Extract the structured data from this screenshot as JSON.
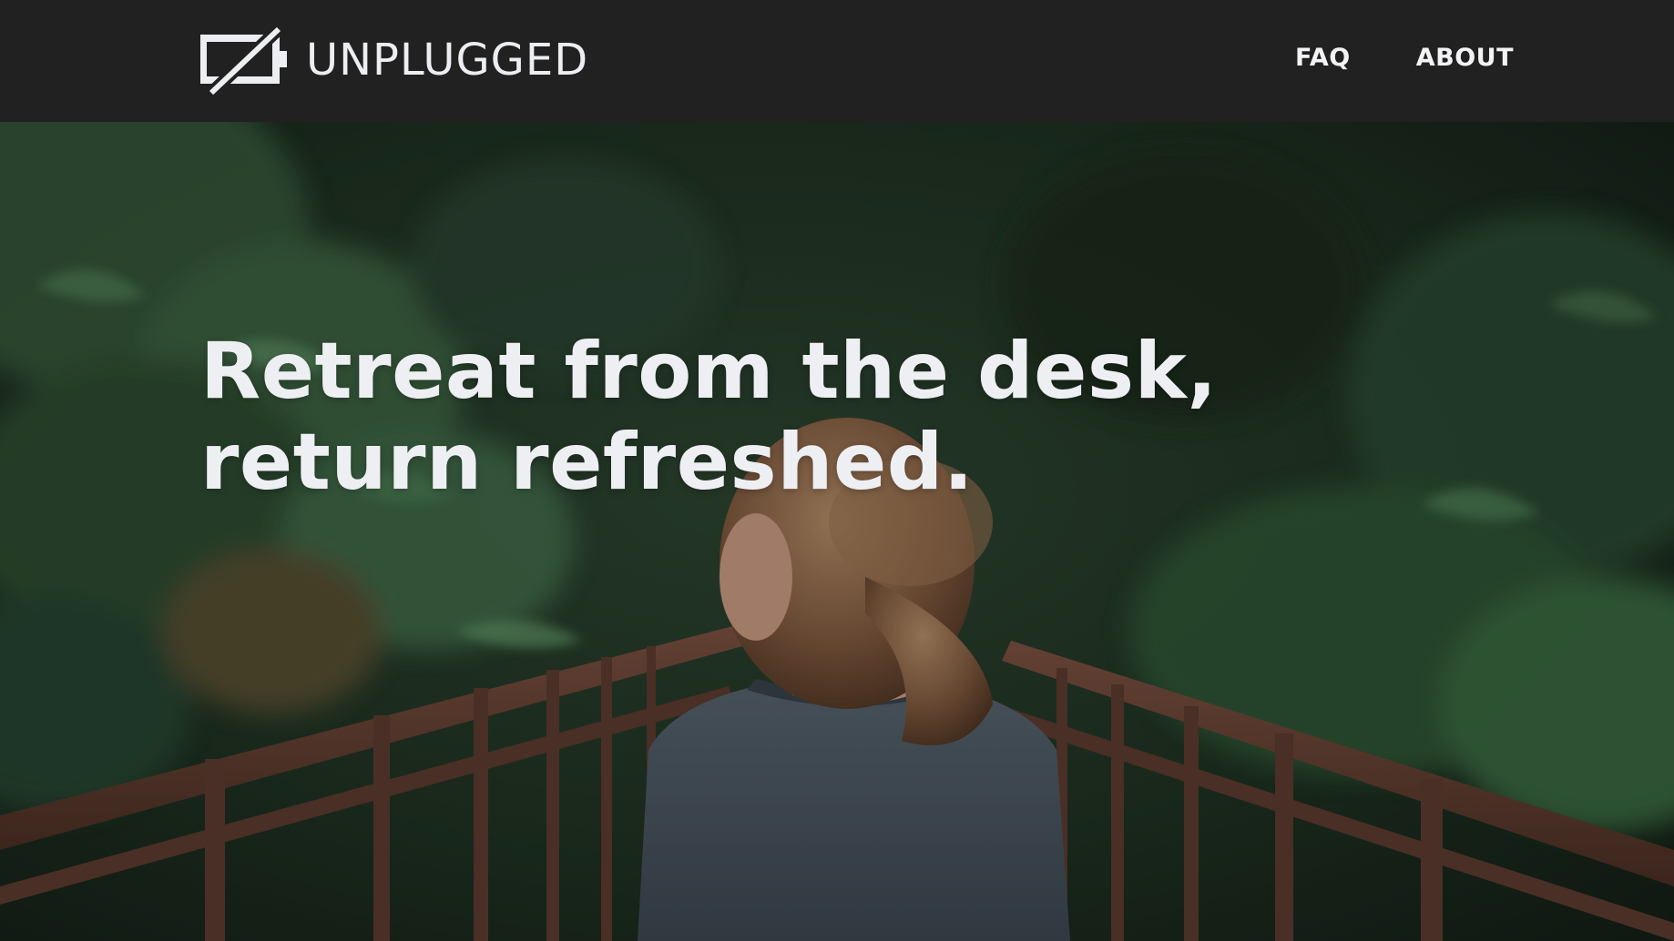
{
  "brand": {
    "name": "UNPLUGGED",
    "logo_icon": "battery-slash-icon"
  },
  "nav": {
    "items": [
      {
        "label": "FAQ"
      },
      {
        "label": "ABOUT"
      }
    ]
  },
  "hero": {
    "headline_line1": "Retreat from the desk,",
    "headline_line2": "return refreshed.",
    "image_subject": "forest-bridge-photo"
  },
  "colors": {
    "topbar": "#212121",
    "text": "#eceef2",
    "forest_dark": "#1b2a1d",
    "forest_mid": "#2f4a33",
    "railing": "#6b4638",
    "shirt": "#4a5660",
    "hair": "#8a6448"
  }
}
